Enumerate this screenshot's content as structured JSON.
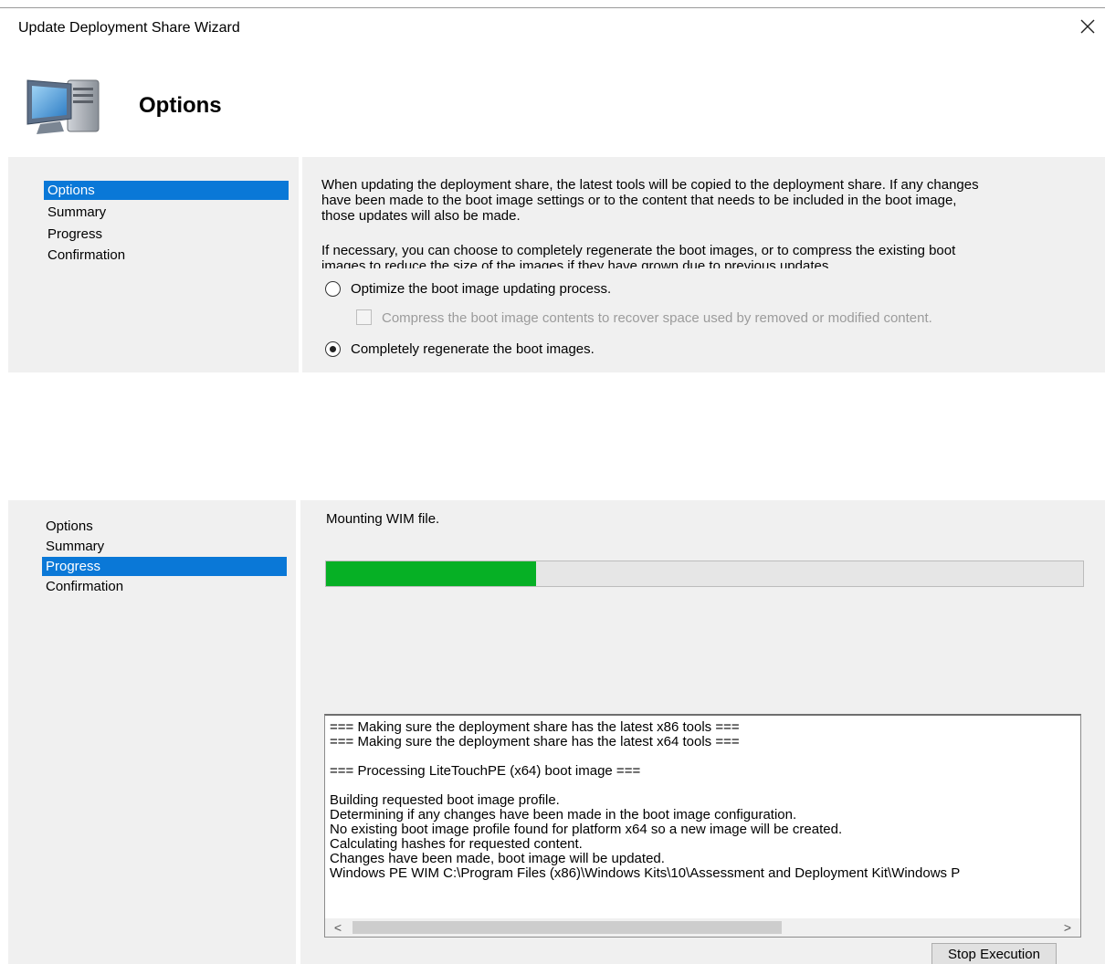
{
  "window": {
    "title": "Update Deployment Share Wizard",
    "close_icon": "close-icon"
  },
  "header": {
    "icon": "computer-icon",
    "title": "Options"
  },
  "options_step": {
    "nav": [
      "Options",
      "Summary",
      "Progress",
      "Confirmation"
    ],
    "selected_nav": "Options",
    "paragraph1": [
      "When updating the deployment share, the latest tools will be copied to the deployment share.  If any changes",
      "have been made to the boot image settings or to the content that needs to be included in the boot image,",
      "those updates will also be made."
    ],
    "paragraph2": [
      "If necessary, you can choose to completely regenerate the boot images, or to compress the existing boot",
      "images to reduce the size of the images if they have grown due to previous updates."
    ],
    "radio_optimize": {
      "label": "Optimize the boot image updating process.",
      "selected": false
    },
    "checkbox_compress": {
      "label": "Compress the boot image contents to recover space used by removed or modified content.",
      "checked": false,
      "enabled": false
    },
    "radio_regenerate": {
      "label": "Completely regenerate the boot images.",
      "selected": true
    }
  },
  "progress_step": {
    "nav": [
      "Options",
      "Summary",
      "Progress",
      "Confirmation"
    ],
    "selected_nav": "Progress",
    "status": "Mounting WIM file.",
    "progress_fraction": 0.277,
    "progress_color": "#06b025",
    "log": [
      "=== Making sure the deployment share has the latest x86 tools ===",
      "=== Making sure the deployment share has the latest x64 tools ===",
      "",
      "=== Processing LiteTouchPE (x64) boot image ===",
      "",
      "Building requested boot image profile.",
      "Determining if any changes have been made in the boot image configuration.",
      "No existing boot image profile found for platform x64 so a new image will be created.",
      "Calculating hashes for requested content.",
      "Changes have been made, boot image will be updated.",
      "Windows PE WIM C:\\Program Files (x86)\\Windows Kits\\10\\Assessment and Deployment Kit\\Windows P"
    ],
    "scroll_left": "<",
    "scroll_right": ">",
    "stop_button": "Stop Execution"
  },
  "colors": {
    "selection": "#0a78d7",
    "panel_gray": "#f0f0f0"
  }
}
